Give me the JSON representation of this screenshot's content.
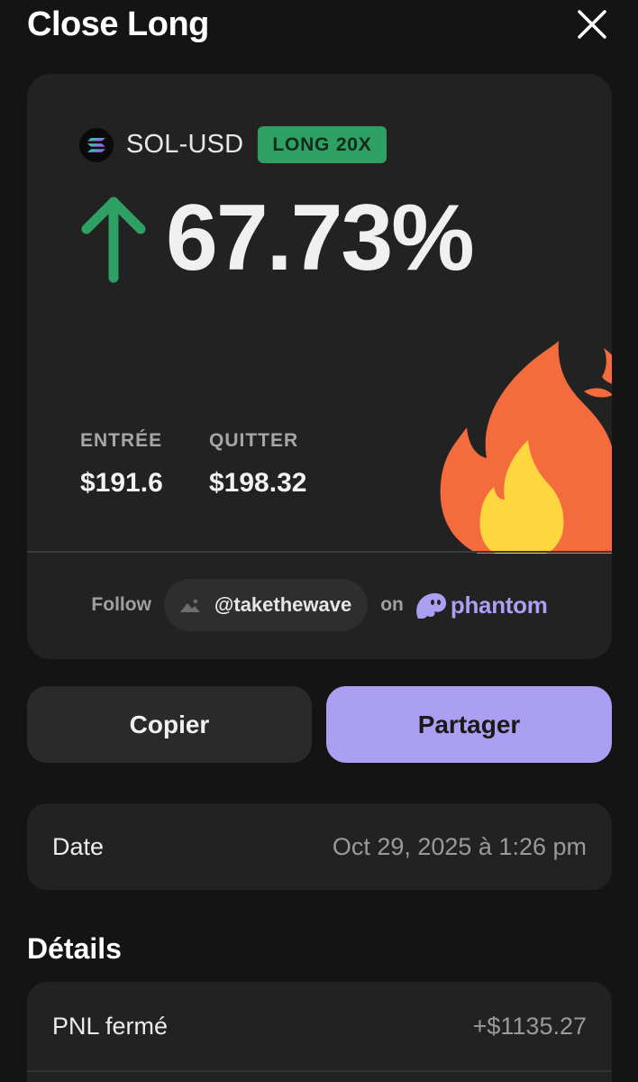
{
  "header": {
    "title": "Close Long"
  },
  "card": {
    "pair": "SOL-USD",
    "badge": "LONG 20X",
    "pnl_percent": "67.73%",
    "entry": {
      "label": "ENTRÉE",
      "value": "$191.6"
    },
    "exit": {
      "label": "QUITTER",
      "value": "$198.32"
    },
    "follow_label": "Follow",
    "handle": "@takethewave",
    "on_label": "on",
    "brand": "phantom"
  },
  "actions": {
    "copy_label": "Copier",
    "share_label": "Partager"
  },
  "date_row": {
    "label": "Date",
    "value": "Oct 29, 2025 à 1:26 pm"
  },
  "details": {
    "title": "Détails",
    "rows": [
      {
        "label": "PNL fermé",
        "value": "+$1135.27"
      }
    ]
  },
  "colors": {
    "background": "#141414",
    "card": "#222222",
    "positive_green": "#2fa063",
    "accent_purple": "#ab9ff2"
  },
  "icons": [
    "close-icon",
    "solana-icon",
    "arrow-up-icon",
    "fire-icon",
    "avatar-placeholder-icon",
    "phantom-ghost-icon"
  ]
}
